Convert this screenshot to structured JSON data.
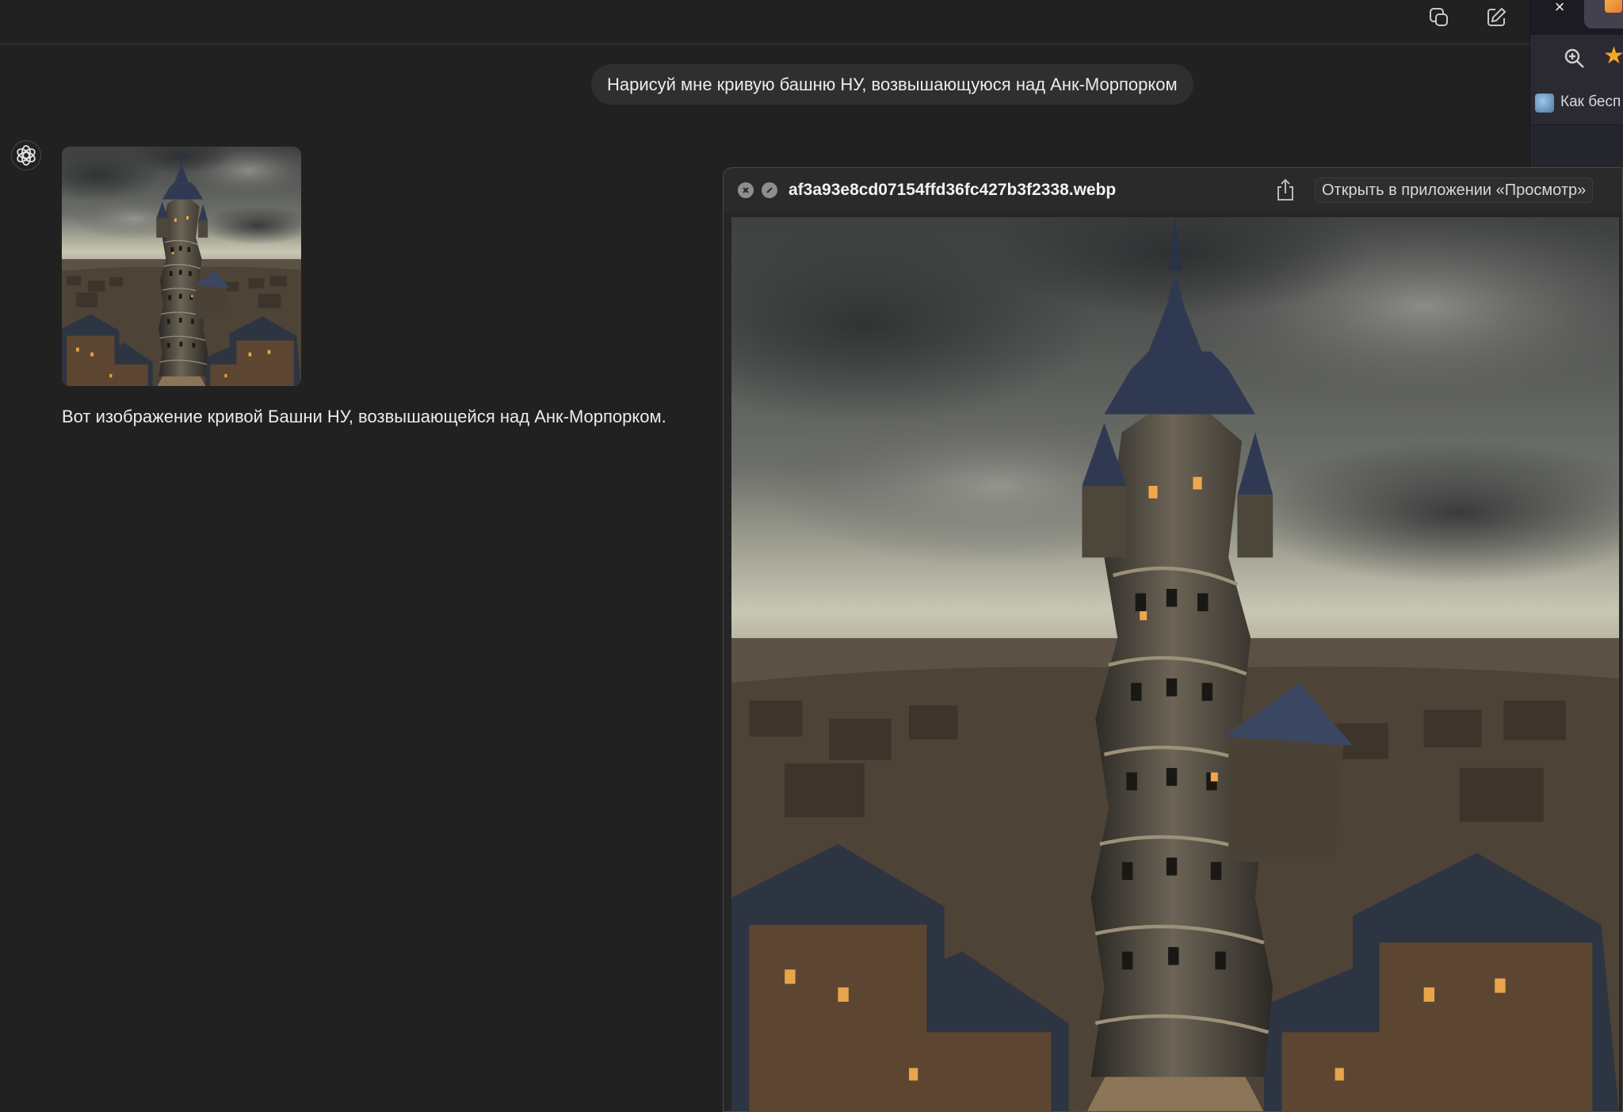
{
  "chat": {
    "user_message": "Нарисуй мне кривую башню НУ, возвышающуюся над Анк-Морпорком",
    "assistant_message": "Вот изображение кривой Башни НУ, возвышающейся над Анк-Морпорком."
  },
  "browser": {
    "tab_close": "×",
    "bookmark_label": "Как бесп",
    "star": "★"
  },
  "quicklook": {
    "filename": "af3a93e8cd07154ffd36fc427b3f2338.webp",
    "open_button_label": "Открыть в приложении «Просмотр»"
  },
  "icons": {
    "new_window": "new-window-icon",
    "compose": "compose-icon",
    "assistant_logo": "openai-logo-icon",
    "share": "share-icon",
    "close": "close-icon",
    "fullscreen": "fullscreen-icon",
    "zoom": "zoom-in-icon",
    "star": "star-icon"
  },
  "colors": {
    "background": "#212121",
    "bubble": "#2f2f2f",
    "text": "#ececec",
    "star": "#f5a623"
  }
}
